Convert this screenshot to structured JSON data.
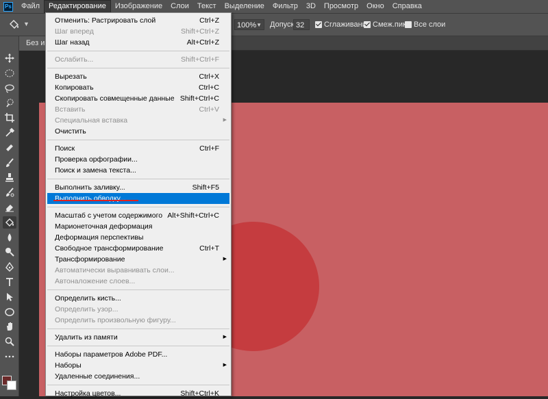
{
  "menubar": {
    "logo": "Ps",
    "items": [
      "Файл",
      "Редактирование",
      "Изображение",
      "Слои",
      "Текст",
      "Выделение",
      "Фильтр",
      "3D",
      "Просмотр",
      "Окно",
      "Справка"
    ],
    "active_index": 1
  },
  "options": {
    "opacity": "100%",
    "tolerance_label": "Допуск:",
    "tolerance": "32",
    "antialias": {
      "label": "Сглаживание",
      "checked": true
    },
    "contiguous": {
      "label": "Смеж.пикс",
      "checked": true
    },
    "all_layers": {
      "label": "Все слои",
      "checked": false
    }
  },
  "document": {
    "tab_title": "Без и",
    "fill_color": "#c86063",
    "circle_color": "#c53c3f"
  },
  "edit_menu": {
    "groups": [
      [
        {
          "label": "Отменить: Растрировать слой",
          "shortcut": "Ctrl+Z",
          "disabled": false
        },
        {
          "label": "Шаг вперед",
          "shortcut": "Shift+Ctrl+Z",
          "disabled": true
        },
        {
          "label": "Шаг назад",
          "shortcut": "Alt+Ctrl+Z",
          "disabled": false
        }
      ],
      [
        {
          "label": "Ослабить...",
          "shortcut": "Shift+Ctrl+F",
          "disabled": true
        }
      ],
      [
        {
          "label": "Вырезать",
          "shortcut": "Ctrl+X",
          "disabled": false
        },
        {
          "label": "Копировать",
          "shortcut": "Ctrl+C",
          "disabled": false
        },
        {
          "label": "Скопировать совмещенные данные",
          "shortcut": "Shift+Ctrl+C",
          "disabled": false
        },
        {
          "label": "Вставить",
          "shortcut": "Ctrl+V",
          "disabled": true
        },
        {
          "label": "Специальная вставка",
          "shortcut": "",
          "disabled": true,
          "submenu": true
        },
        {
          "label": "Очистить",
          "shortcut": "",
          "disabled": false
        }
      ],
      [
        {
          "label": "Поиск",
          "shortcut": "Ctrl+F",
          "disabled": false
        },
        {
          "label": "Проверка орфографии...",
          "shortcut": "",
          "disabled": false
        },
        {
          "label": "Поиск и замена текста...",
          "shortcut": "",
          "disabled": false
        }
      ],
      [
        {
          "label": "Выполнить заливку...",
          "shortcut": "Shift+F5",
          "disabled": false
        },
        {
          "label": "Выполнить обводку...",
          "shortcut": "",
          "disabled": false,
          "highlighted": true
        }
      ],
      [
        {
          "label": "Масштаб с учетом содержимого",
          "shortcut": "Alt+Shift+Ctrl+C",
          "disabled": false
        },
        {
          "label": "Марионеточная деформация",
          "shortcut": "",
          "disabled": false
        },
        {
          "label": "Деформация перспективы",
          "shortcut": "",
          "disabled": false
        },
        {
          "label": "Свободное трансформирование",
          "shortcut": "Ctrl+T",
          "disabled": false
        },
        {
          "label": "Трансформирование",
          "shortcut": "",
          "disabled": false,
          "submenu": true
        },
        {
          "label": "Автоматически выравнивать слои...",
          "shortcut": "",
          "disabled": true
        },
        {
          "label": "Автоналожение слоев...",
          "shortcut": "",
          "disabled": true
        }
      ],
      [
        {
          "label": "Определить кисть...",
          "shortcut": "",
          "disabled": false
        },
        {
          "label": "Определить узор...",
          "shortcut": "",
          "disabled": true
        },
        {
          "label": "Определить произвольную фигуру...",
          "shortcut": "",
          "disabled": true
        }
      ],
      [
        {
          "label": "Удалить из памяти",
          "shortcut": "",
          "disabled": false,
          "submenu": true
        }
      ],
      [
        {
          "label": "Наборы параметров Adobe PDF...",
          "shortcut": "",
          "disabled": false
        },
        {
          "label": "Наборы",
          "shortcut": "",
          "disabled": false,
          "submenu": true
        },
        {
          "label": "Удаленные соединения...",
          "shortcut": "",
          "disabled": false
        }
      ],
      [
        {
          "label": "Настройка цветов...",
          "shortcut": "Shift+Ctrl+K",
          "disabled": false
        }
      ]
    ]
  },
  "tools": [
    "move-icon",
    "marquee-icon",
    "lasso-icon",
    "quick-select-icon",
    "crop-icon",
    "eyedropper-icon",
    "healing-icon",
    "brush-icon",
    "stamp-icon",
    "history-brush-icon",
    "eraser-icon",
    "paint-bucket-icon",
    "blur-icon",
    "dodge-icon",
    "pen-icon",
    "type-icon",
    "path-select-icon",
    "ellipse-icon",
    "hand-icon",
    "zoom-icon",
    "more-icon"
  ],
  "selected_tool": "paint-bucket-icon"
}
